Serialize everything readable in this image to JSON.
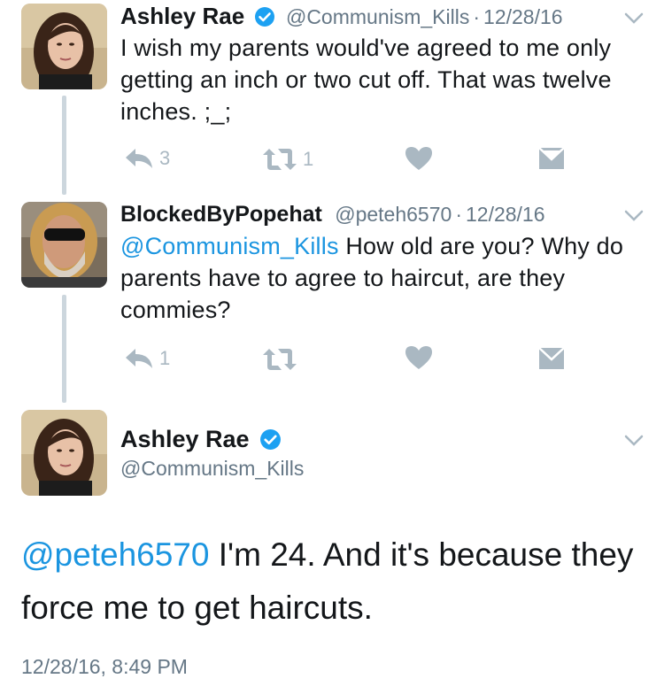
{
  "tweets": [
    {
      "name": "Ashley Rae",
      "handle": "@Communism_Kills",
      "dot": "·",
      "date": "12/28/16",
      "text": "I wish my parents would've agreed to me only getting an inch or two cut off. That was twelve inches. ;_;",
      "reply_count": "3",
      "retweet_count": "1"
    },
    {
      "name": "BlockedByPopehat",
      "handle": "@peteh6570",
      "dot": "·",
      "date": "12/28/16",
      "mention": "@Communism_Kills",
      "text": " How old are you? Why do parents have to agree to haircut, are they commies?",
      "reply_count": "1"
    }
  ],
  "focused": {
    "name": "Ashley Rae",
    "handle": "@Communism_Kills",
    "mention": "@peteh6570",
    "text": " I'm 24. And it's because they force me to get haircuts.",
    "timestamp": "12/28/16, 8:49 PM"
  },
  "colors": {
    "link": "#1b95e0",
    "verified": "#1da1f2",
    "icon_gray": "#aab8c2",
    "secondary_text": "#657786",
    "thread_line": "#ccd6dd"
  },
  "icons": [
    "reply-icon",
    "retweet-icon",
    "like-icon",
    "dm-icon",
    "verified-icon",
    "chevron-down-icon"
  ]
}
